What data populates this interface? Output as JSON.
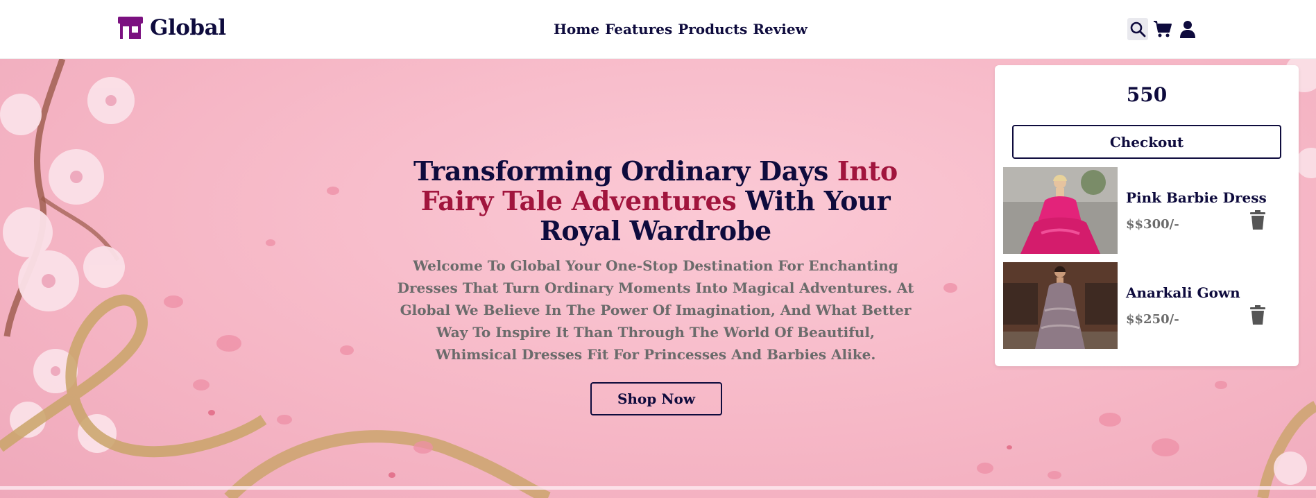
{
  "header": {
    "brand": "Global",
    "nav": [
      "Home",
      "Features",
      "Products",
      "Review"
    ],
    "icons": [
      "search-icon",
      "cart-icon",
      "user-icon"
    ]
  },
  "hero": {
    "title_part1": "Transforming Ordinary Days ",
    "title_accent": "Into Fairy Tale Adventures",
    "title_part2": " With Your Royal Wardrobe",
    "description": "Welcome To Global Your One-Stop Destination For Enchanting Dresses That Turn Ordinary Moments Into Magical Adventures. At Global We Believe In The Power Of Imagination, And What Better Way To Inspire It Than Through The World Of Beautiful, Whimsical Dresses Fit For Princesses And Barbies Alike.",
    "cta": "Shop Now"
  },
  "cart": {
    "total": "550",
    "checkout_label": "Checkout",
    "items": [
      {
        "name": "Pink Barbie Dress",
        "price": "$$300/-"
      },
      {
        "name": "Anarkali Gown",
        "price": "$$250/-"
      }
    ]
  },
  "colors": {
    "navy": "#0e0b3d",
    "accent": "#a1153d",
    "logo": "#7b1180",
    "hero_bg": "#f6b7c6",
    "muted_text": "#6b6b6b"
  }
}
